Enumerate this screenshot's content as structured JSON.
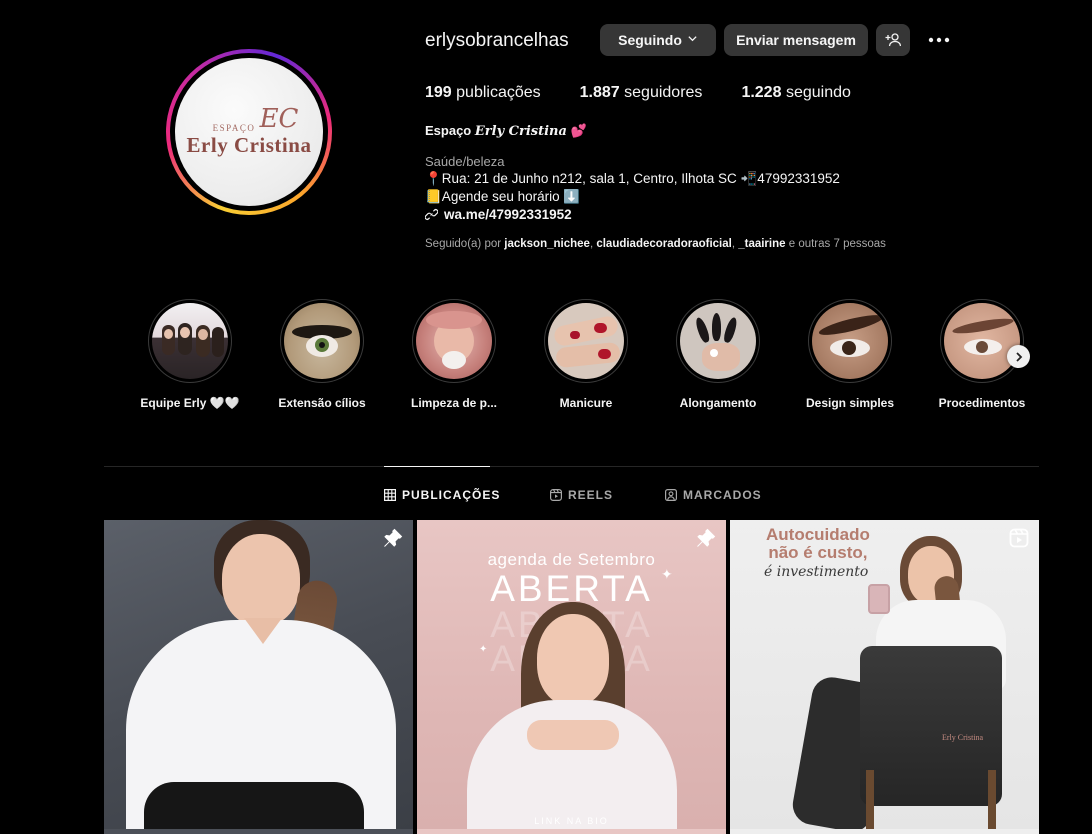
{
  "profile": {
    "username": "erlysobrancelhas",
    "follow_button": "Seguindo",
    "message_button": "Enviar mensagem",
    "avatar_logo": {
      "monogram": "EC",
      "espaco": "ESPAÇO",
      "name": "Erly Cristina"
    },
    "stats": {
      "posts_count": "199",
      "posts_label": "publicações",
      "followers_count": "1.887",
      "followers_label": "seguidores",
      "following_count": "1.228",
      "following_label": "seguindo"
    },
    "bio": {
      "name_prefix": "Espaço",
      "name_styled": "Erly Cristina",
      "name_emoji": "💕",
      "category": "Saúde/beleza",
      "line1": "📍Rua: 21 de Junho n212, sala 1, Centro, Ilhota SC 📲47992331952",
      "line2": "📒Agende seu horário ⬇️",
      "link": "wa.me/47992331952"
    },
    "followed_by": {
      "prefix": "Seguido(a) por",
      "user1": "jackson_nichee",
      "user2": "claudiadecoradoraoficial",
      "user3": "_taairine",
      "suffix": "e outras 7 pessoas"
    }
  },
  "highlights": [
    {
      "label": "Equipe Erly 🤍🤍"
    },
    {
      "label": "Extensão cílios"
    },
    {
      "label": "Limpeza de p..."
    },
    {
      "label": "Manicure"
    },
    {
      "label": "Alongamento"
    },
    {
      "label": "Design simples"
    },
    {
      "label": "Procedimentos"
    }
  ],
  "tabs": [
    {
      "label": "PUBLICAÇÕES",
      "icon": "grid-icon",
      "active": true
    },
    {
      "label": "REELS",
      "icon": "reels-icon",
      "active": false
    },
    {
      "label": "MARCADOS",
      "icon": "tagged-icon",
      "active": false
    }
  ],
  "posts": [
    {
      "type": "pinned-photo",
      "icon": "pin-icon"
    },
    {
      "type": "pinned-graphic",
      "icon": "pin-icon",
      "text_small": "agenda de Setembro",
      "text_big": "ABERTA",
      "text_link": "LINK NA BIO"
    },
    {
      "type": "reel",
      "icon": "reel-icon",
      "title_line1": "Autocuidado",
      "title_line2": "não é custo,",
      "subtitle": "é investimento",
      "chair_logo": "Erly Cristina"
    }
  ]
}
